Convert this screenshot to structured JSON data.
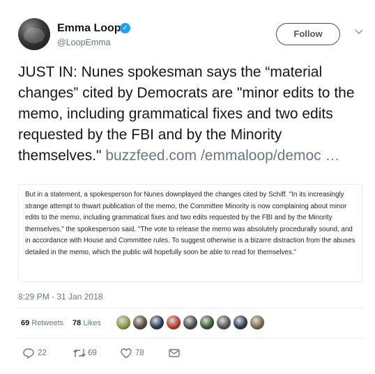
{
  "author": {
    "name": "Emma Loop",
    "handle": "@LoopEmma",
    "verified": true,
    "follow_label": "Follow"
  },
  "tweet": {
    "text": "JUST IN: Nunes spokesman says the “material changes” cited by Democrats are \"minor edits to the memo, including grammatical fixes and two edits requested by the FBI and by the Minority themselves.\"",
    "link_line1": "buzzfeed.com",
    "link_line2": "/emmaloop/democ",
    "link_ellipsis": "…"
  },
  "quote_card": {
    "text": "But in a statement, a spokesperson for Nunes downplayed the changes cited by Schiff. \"In its increasingly strange attempt to thwart publication of the memo, the Committee Minority is now complaining about minor edits to the memo, including grammatical fixes and two edits requested by the FBI and by the Minority themselves,\" the spokesperson said. \"The vote to release the memo was absolutely procedurally sound, and in accordance with House and Committee rules. To suggest otherwise is a bizarre distraction from the abuses detailed in the memo, which the public will hopefully soon be able to read for themselves.\""
  },
  "timestamp": "8:29 PM - 31 Jan 2018",
  "stats": {
    "retweets_count": "69",
    "retweets_label": "Retweets",
    "likes_count": "78",
    "likes_label": "Likes"
  },
  "liker_avatars": [
    "#8c9a4a",
    "#5a4a3a",
    "#2a3a5a",
    "#c0392b",
    "#4a4a4a",
    "#3a5a2a",
    "#555555",
    "#2c3e50",
    "#7a6a4a"
  ],
  "actions": {
    "reply_count": "22",
    "retweet_count": "69",
    "like_count": "78"
  },
  "colors": {
    "verified_blue": "#1da1f2",
    "secondary_text": "#657786"
  }
}
